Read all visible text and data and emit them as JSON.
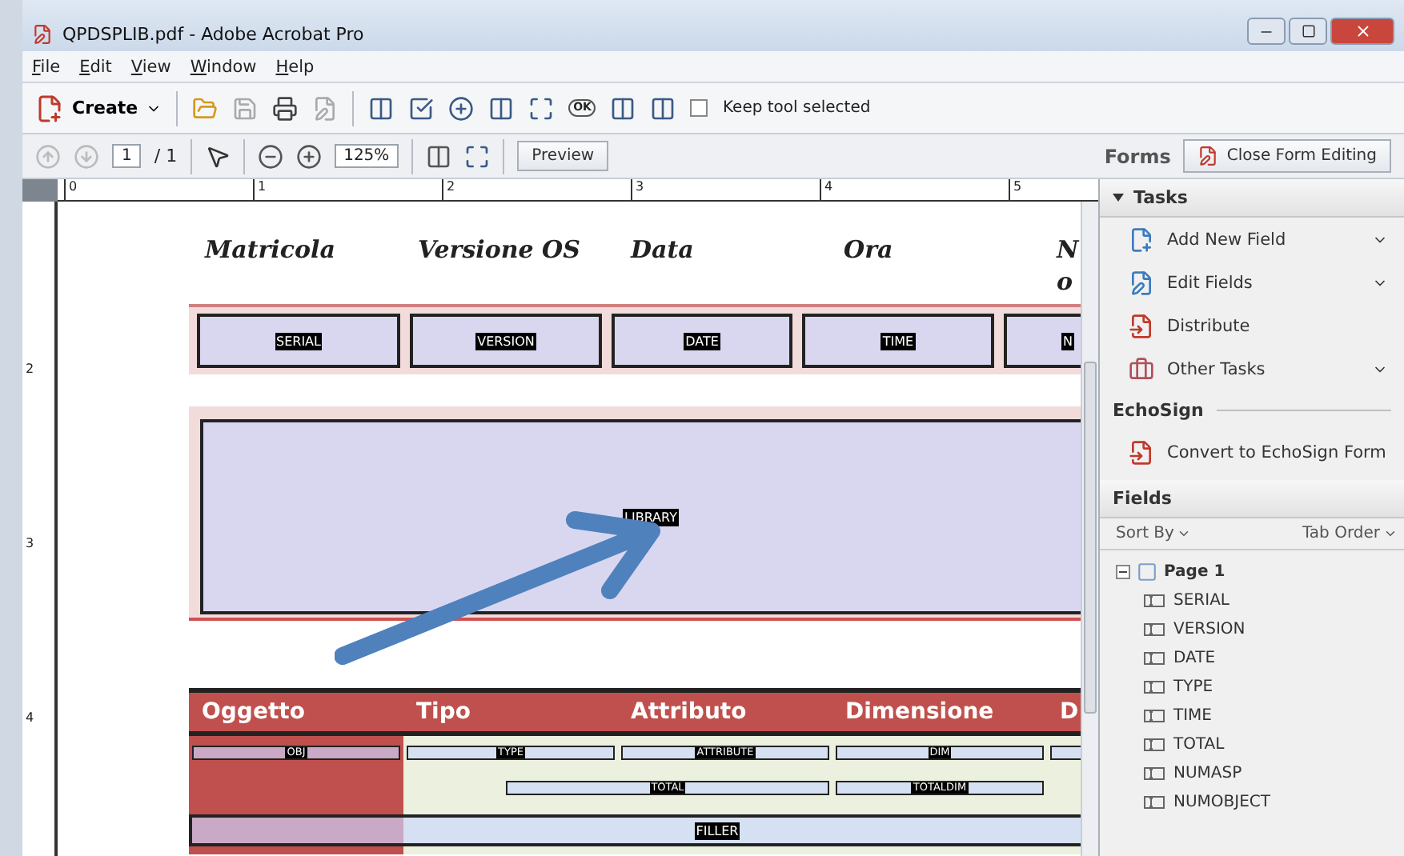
{
  "window": {
    "title": "QPDSPLIB.pdf - Adobe Acrobat Pro"
  },
  "menu": [
    "File",
    "Edit",
    "View",
    "Window",
    "Help"
  ],
  "toolbar": {
    "create": "Create",
    "button_tool_label": "OK",
    "keep_tool_selected": {
      "label": "Keep tool selected",
      "checked": false
    }
  },
  "nav": {
    "page": "1",
    "page_count": "/ 1",
    "zoom": "125%",
    "preview": "Preview"
  },
  "forms": {
    "title": "Forms",
    "close_button": "Close Form Editing"
  },
  "ruler": {
    "horizontal": [
      "0",
      "1",
      "2",
      "3",
      "4",
      "5"
    ],
    "vertical": [
      "2",
      "3",
      "4"
    ]
  },
  "document": {
    "headers": [
      "Matricola",
      "Versione OS",
      "Data",
      "Ora",
      "N\no"
    ],
    "fields": [
      "SERIAL",
      "VERSION",
      "DATE",
      "TIME",
      "N"
    ],
    "library_field": "LIBRARY",
    "table": {
      "columns": [
        "Oggetto",
        "Tipo",
        "Attributo",
        "Dimensione",
        "D"
      ],
      "row_1": [
        "OBJ",
        "TYPE",
        "ATTRIBUTE",
        "DIM"
      ],
      "row_2": [
        "TOTAL",
        "TOTALDIM"
      ],
      "filler": "FILLER"
    }
  },
  "tasks": {
    "title": "Tasks",
    "expanded": true,
    "items": [
      {
        "label": "Add New Field",
        "kind": "add",
        "has_menu": true
      },
      {
        "label": "Edit Fields",
        "kind": "edit",
        "has_menu": true
      },
      {
        "label": "Distribute",
        "kind": "distribute",
        "has_menu": false
      },
      {
        "label": "Other Tasks",
        "kind": "other",
        "has_menu": true
      }
    ]
  },
  "echosign": {
    "title": "EchoSign",
    "items": [
      "Convert to EchoSign Form"
    ]
  },
  "fields": {
    "title": "Fields",
    "sort_by": "Sort By",
    "tab_order": "Tab Order",
    "tree": {
      "label": "Page 1",
      "expanded": true,
      "children": [
        {
          "label": "SERIAL"
        },
        {
          "label": "VERSION"
        },
        {
          "label": "DATE"
        },
        {
          "label": "TYPE"
        },
        {
          "label": "TIME"
        },
        {
          "label": "TOTAL"
        },
        {
          "label": "NUMASP"
        },
        {
          "label": "NUMOBJECT"
        }
      ]
    }
  }
}
